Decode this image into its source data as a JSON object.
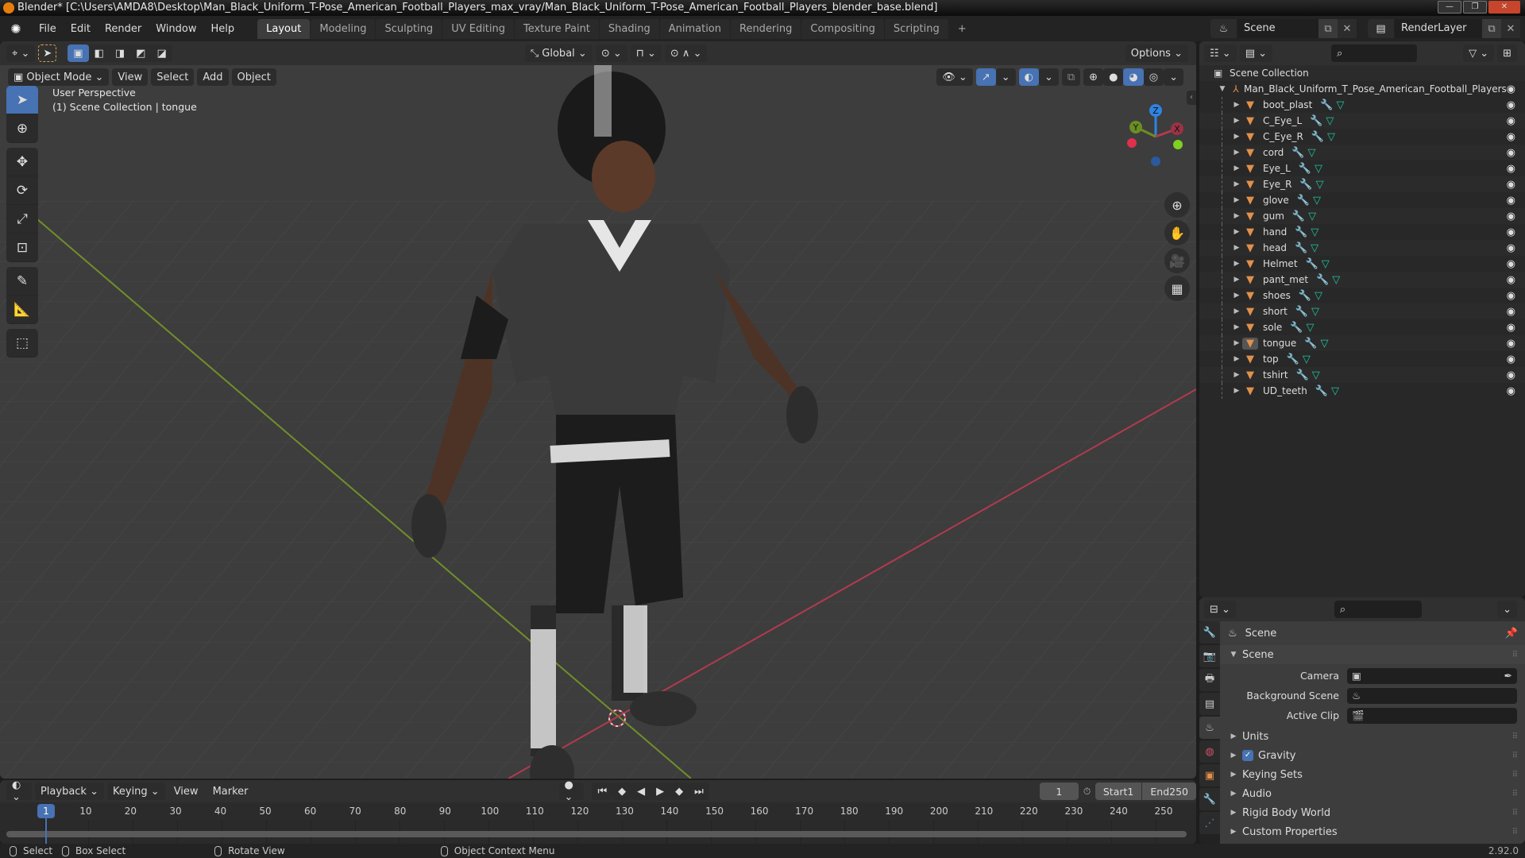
{
  "window": {
    "title": "Blender* [C:\\Users\\AMDA8\\Desktop\\Man_Black_Uniform_T-Pose_American_Football_Players_max_vray/Man_Black_Uniform_T-Pose_American_Football_Players_blender_base.blend]",
    "minimize": "—",
    "maximize": "❐",
    "close": "✕"
  },
  "menu": [
    "File",
    "Edit",
    "Render",
    "Window",
    "Help"
  ],
  "workspaces": [
    "Layout",
    "Modeling",
    "Sculpting",
    "UV Editing",
    "Texture Paint",
    "Shading",
    "Animation",
    "Rendering",
    "Compositing",
    "Scripting"
  ],
  "workspace_active": "Layout",
  "add_workspace": "+",
  "scene_selector": {
    "name": "Scene"
  },
  "viewlayer_selector": {
    "name": "RenderLayer"
  },
  "viewport": {
    "transform_orientation": "Global",
    "options_label": "Options",
    "mode": "Object Mode",
    "header_menus": [
      "View",
      "Select",
      "Add",
      "Object"
    ],
    "overlay_line1": "User Perspective",
    "overlay_line2": "(1) Scene Collection | tongue",
    "gizmo_axes": {
      "z": "Z",
      "y": "Y",
      "x": "X"
    },
    "colors": {
      "x_axis": "#c23a4e",
      "y_axis": "#6b8e23",
      "z_axis": "#2f83e3",
      "active": "#4772b3"
    }
  },
  "outliner": {
    "root": "Scene Collection",
    "collection": "Man_Black_Uniform_T_Pose_American_Football_Players",
    "objects": [
      "boot_plast",
      "C_Eye_L",
      "C_Eye_R",
      "cord",
      "Eye_L",
      "Eye_R",
      "glove",
      "gum",
      "hand",
      "head",
      "Helmet",
      "pant_met",
      "shoes",
      "short",
      "sole",
      "tongue",
      "top",
      "tshirt",
      "UD_teeth"
    ],
    "active_object": "tongue"
  },
  "properties": {
    "context": "Scene",
    "panel_title": "Scene",
    "fields": [
      {
        "label": "Camera",
        "value": ""
      },
      {
        "label": "Background Scene",
        "value": ""
      },
      {
        "label": "Active Clip",
        "value": ""
      }
    ],
    "subpanels": [
      "Units",
      "Gravity",
      "Keying Sets",
      "Audio",
      "Rigid Body World",
      "Custom Properties"
    ],
    "gravity_checked": true
  },
  "timeline": {
    "menus": [
      "Playback",
      "Keying",
      "View",
      "Marker"
    ],
    "current_frame": "1",
    "start_label": "Start",
    "start": "1",
    "end_label": "End",
    "end": "250",
    "ticks": [
      "10",
      "20",
      "30",
      "40",
      "50",
      "60",
      "70",
      "80",
      "90",
      "100",
      "110",
      "120",
      "130",
      "140",
      "150",
      "160",
      "170",
      "180",
      "190",
      "200",
      "210",
      "220",
      "230",
      "240",
      "250"
    ],
    "playhead": "1"
  },
  "statusbar": {
    "select": "Select",
    "box_select": "Box Select",
    "rotate_view": "Rotate View",
    "context_menu": "Object Context Menu",
    "version": "2.92.0"
  }
}
